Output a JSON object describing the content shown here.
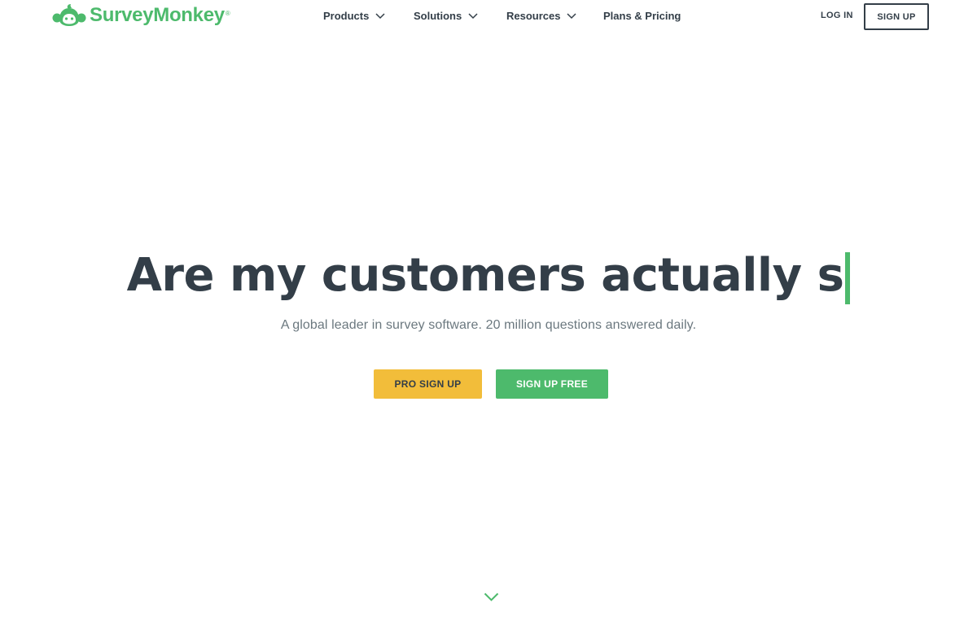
{
  "brand": {
    "name": "SurveyMonkey",
    "registered_mark": "®",
    "color": "#4dba6c",
    "logo_icon": "monkey-logo-icon"
  },
  "nav": {
    "items": [
      {
        "label": "Products",
        "icon": "chevron-down-icon"
      },
      {
        "label": "Solutions",
        "icon": "chevron-down-icon"
      },
      {
        "label": "Resources",
        "icon": "chevron-down-icon"
      },
      {
        "label": "Plans & Pricing"
      }
    ]
  },
  "auth": {
    "login_label": "LOG IN",
    "signup_label": "SIGN UP"
  },
  "hero": {
    "title": "Are my customers actually s",
    "subtitle": "A global leader in survey software. 20 million questions answered daily.",
    "cursor_color": "#4dba6c"
  },
  "cta": {
    "pro_label": "PRO SIGN UP",
    "free_label": "SIGN UP FREE",
    "pro_color": "#f2bd3a",
    "free_color": "#4dba6c"
  },
  "scroll": {
    "icon": "chevron-down-icon",
    "color": "#4dba6c"
  },
  "colors": {
    "text": "#333e48",
    "muted": "#6b787f",
    "background": "#ffffff"
  }
}
